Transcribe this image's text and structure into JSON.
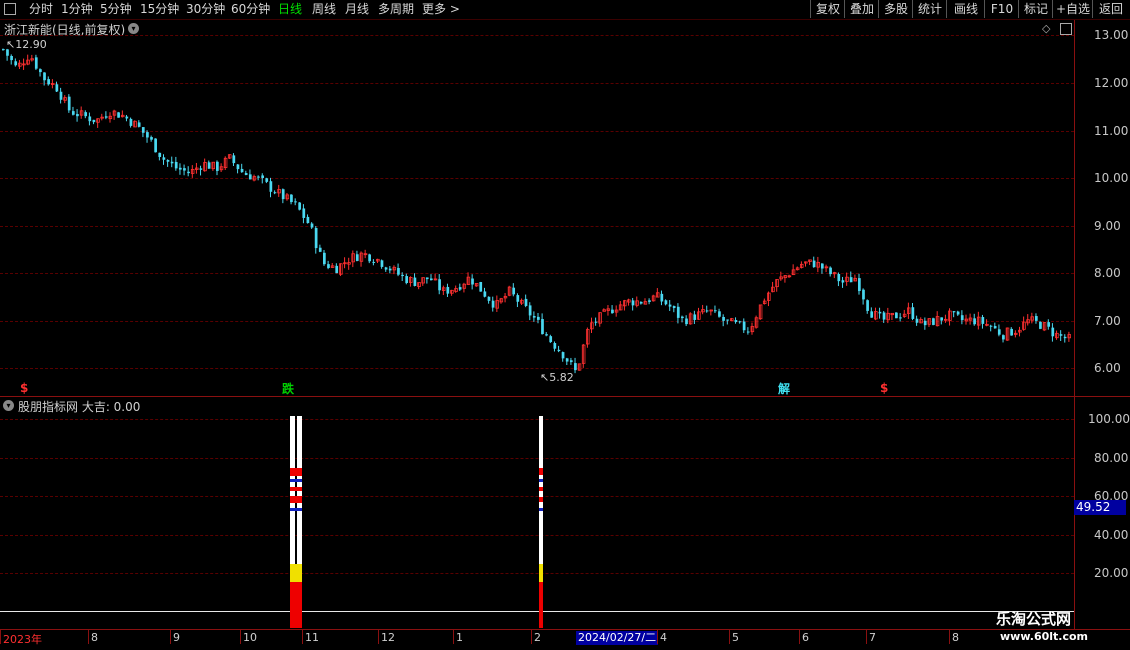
{
  "toolbar": {
    "periods": [
      "分时",
      "1分钟",
      "5分钟",
      "15分钟",
      "30分钟",
      "60分钟",
      "日线",
      "周线",
      "月线",
      "多周期",
      "更多 >"
    ],
    "active_period": "日线",
    "right_buttons": [
      "复权",
      "叠加",
      "多股",
      "统计",
      "画线",
      "F10",
      "标记",
      "+自选",
      "返回"
    ]
  },
  "main": {
    "title": "浙江新能(日线,前复权)",
    "high_label": "12.90",
    "low_label": "5.82",
    "y_ticks": [
      "13.00",
      "12.00",
      "11.00",
      "10.00",
      "9.00",
      "8.00",
      "7.00",
      "6.00"
    ],
    "signals": [
      "$",
      "跌",
      "解",
      "$"
    ]
  },
  "sub": {
    "title": "股朋指标网 大吉: 0.00",
    "y_ticks": [
      "100.00",
      "80.00",
      "60.00",
      "40.00",
      "20.00"
    ],
    "cursor_value": "49.52"
  },
  "x_axis": {
    "labels": [
      "2023年",
      "8",
      "9",
      "10",
      "11",
      "12",
      "1",
      "2",
      "4",
      "5",
      "6",
      "7",
      "8"
    ],
    "cursor_date": "2024/02/27/二"
  },
  "watermark": {
    "line1": "乐淘公式网",
    "line2": "www.60lt.com"
  },
  "colors": {
    "up": "#ff3030",
    "down": "#4ad8f0",
    "active": "#00e000",
    "cursor_bg": "#0000a0",
    "grid": "#5a0000"
  },
  "chart_data": {
    "type": "candlestick",
    "title": "浙江新能(日线,前复权)",
    "ylim": [
      5.6,
      13.3
    ],
    "annotations": [
      {
        "label": "12.90",
        "type": "high"
      },
      {
        "label": "5.82",
        "type": "low"
      }
    ],
    "close_path": [
      12.7,
      12.3,
      12.6,
      12.1,
      11.9,
      11.4,
      11.3,
      11.2,
      11.4,
      11.3,
      11.1,
      10.8,
      10.4,
      10.2,
      10.1,
      10.3,
      10.2,
      10.4,
      10.1,
      10.0,
      9.8,
      9.6,
      9.4,
      9.0,
      8.2,
      8.1,
      8.3,
      8.4,
      8.3,
      8.1,
      7.9,
      7.8,
      7.9,
      7.6,
      7.7,
      7.9,
      7.6,
      7.3,
      7.6,
      7.3,
      7.0,
      6.6,
      6.3,
      5.9,
      6.9,
      7.1,
      7.3,
      7.4,
      7.4,
      7.5,
      7.3,
      7.0,
      7.1,
      7.2,
      7.0,
      6.9,
      6.8,
      7.4,
      7.8,
      8.0,
      8.2,
      8.2,
      8.0,
      7.8,
      7.9,
      7.2,
      7.0,
      7.1,
      7.2,
      6.9,
      7.0,
      7.1,
      7.0,
      7.0,
      6.9,
      6.7,
      6.8,
      7.0,
      6.9,
      6.7,
      6.6
    ]
  }
}
